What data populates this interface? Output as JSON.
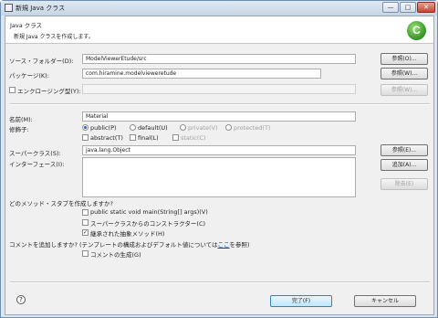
{
  "window": {
    "title": "新規 Java クラス",
    "minimize": "—",
    "maximize": "□",
    "close": "✕"
  },
  "banner": {
    "title": "Java クラス",
    "message": "新規 Java クラスを作成します。",
    "logo": "C"
  },
  "source_folder": {
    "label": "ソース・フォルダー(D):",
    "value": "ModelViewerEtude/src",
    "browse": "参照(O)..."
  },
  "package": {
    "label": "パッケージ(K):",
    "value": "com.hiramine.modelvieweretude",
    "browse": "参照(W)..."
  },
  "enclosing": {
    "label": "エンクロージング型(Y):",
    "value": "",
    "browse": "参照(W)...",
    "checked": false
  },
  "name": {
    "label": "名前(M):",
    "value": "Material"
  },
  "modifiers": {
    "label": "修飾子:",
    "public": "public(P)",
    "default": "default(U)",
    "private": "private(V)",
    "protected": "protected(T)",
    "abstract": "abstract(T)",
    "final": "final(L)",
    "static": "static(C)",
    "selected": "public"
  },
  "superclass": {
    "label": "スーパークラス(S):",
    "value": "java.lang.Object",
    "browse": "参照(E)..."
  },
  "interfaces": {
    "label": "インターフェース(I):",
    "add": "追加(A)...",
    "remove": "除去(E)"
  },
  "stubs": {
    "question": "どのメソッド・スタブを作成しますか?",
    "main": "public static void main(String[] args)(V)",
    "constructors": "スーパークラスからのコンストラクター(C)",
    "inherited": "継承された抽象メソッド(H)",
    "inherited_checked": true
  },
  "comments": {
    "question_prefix": "コメントを追加しますか? (テンプレートの構成およびデフォルト値については",
    "link": "ここ",
    "question_suffix": "を参照)",
    "generate": "コメントの生成(G)"
  },
  "footer": {
    "help": "?",
    "finish": "完了(F)",
    "cancel": "キャンセル"
  }
}
